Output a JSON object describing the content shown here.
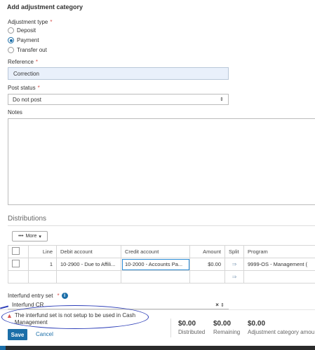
{
  "page": {
    "title": "Add adjustment category"
  },
  "form": {
    "adjustment_type": {
      "label": "Adjustment type",
      "required_mark": "*",
      "options": [
        "Deposit",
        "Payment",
        "Transfer out"
      ],
      "selected": "Payment"
    },
    "reference": {
      "label": "Reference",
      "required_mark": "*",
      "value": "Correction"
    },
    "post_status": {
      "label": "Post status",
      "required_mark": "*",
      "value": "Do not post"
    },
    "notes": {
      "label": "Notes",
      "value": ""
    }
  },
  "distributions": {
    "title": "Distributions",
    "more_label": "More",
    "columns": [
      "Line",
      "Debit account",
      "Credit account",
      "Amount",
      "Split",
      "Program"
    ],
    "rows": [
      {
        "line": "1",
        "debit": "10-2900 - Due to Affili...",
        "credit": "10-2000 - Accounts Pa...",
        "amount": "$0.00",
        "program": "9999-OS - Management ("
      }
    ]
  },
  "interfund": {
    "label": "Interfund entry set",
    "required_mark": "*",
    "info_icon": "i",
    "value": "Interfund CR"
  },
  "footer": {
    "error_text": "The interfund set is not setup to be used in Cash Management",
    "save_label": "Save",
    "cancel_label": "Cancel",
    "summary": [
      {
        "value": "$0.00",
        "caption": "Distributed"
      },
      {
        "value": "$0.00",
        "caption": "Remaining"
      },
      {
        "value": "$0.00",
        "caption": "Adjustment category amou"
      }
    ]
  },
  "colors": {
    "primary": "#1b6ea8",
    "required": "#d9534f",
    "input_bg": "#e9f0fb",
    "annotation": "#2d3eb8"
  },
  "icons": {
    "split": "split-icon",
    "info": "info-icon",
    "warning": "warning-icon",
    "caret": "caret-down-icon"
  }
}
